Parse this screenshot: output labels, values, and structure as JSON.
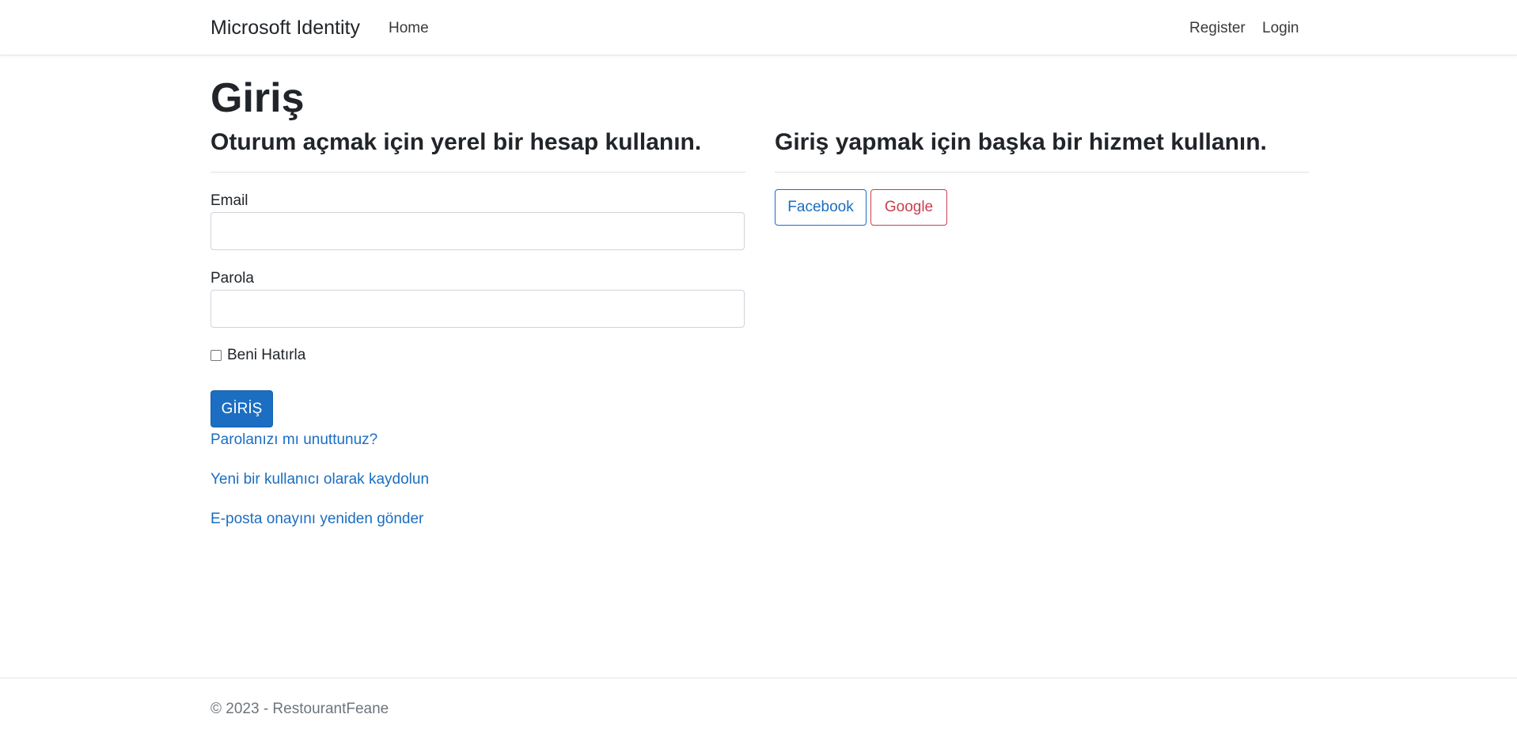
{
  "navbar": {
    "brand": "Microsoft Identity",
    "home": "Home",
    "register": "Register",
    "login": "Login"
  },
  "page": {
    "title": "Giriş"
  },
  "local_login": {
    "heading": "Oturum açmak için yerel bir hesap kullanın.",
    "email_label": "Email",
    "email_value": "",
    "password_label": "Parola",
    "password_value": "",
    "remember_label": "Beni Hatırla",
    "remember_checked": false,
    "submit_label": "GİRİŞ",
    "forgot_password_link": "Parolanızı mı unuttunuz?",
    "register_link": "Yeni bir kullanıcı olarak kaydolun",
    "resend_confirmation_link": "E-posta onayını yeniden gönder"
  },
  "external_login": {
    "heading": "Giriş yapmak için başka bir hizmet kullanın.",
    "providers": [
      {
        "label": "Facebook",
        "color": "#1b6ec2"
      },
      {
        "label": "Google",
        "color": "#c6404f"
      }
    ]
  },
  "footer": {
    "text": "© 2023 - RestourantFeane"
  },
  "colors": {
    "primary": "#1b6ec2",
    "danger": "#c6404f",
    "text": "#212529",
    "muted": "#6c757d"
  }
}
